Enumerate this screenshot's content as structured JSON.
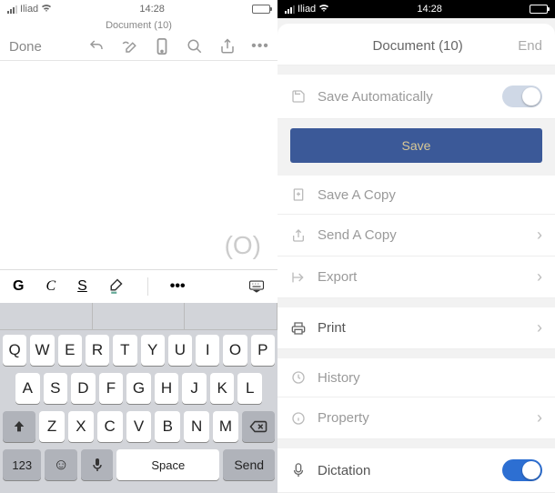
{
  "status": {
    "carrier": "Iliad",
    "time": "14:28"
  },
  "left": {
    "doc_title": "Document (10)",
    "done": "Done",
    "format": {
      "bold": "G",
      "italic": "C",
      "underline": "S",
      "more": "•••"
    },
    "cursor_badge": "(O)"
  },
  "keyboard": {
    "row1": [
      "Q",
      "W",
      "E",
      "R",
      "T",
      "Y",
      "U",
      "I",
      "O",
      "P"
    ],
    "row2": [
      "A",
      "S",
      "D",
      "F",
      "G",
      "H",
      "J",
      "K",
      "L"
    ],
    "row3": [
      "Z",
      "X",
      "C",
      "V",
      "B",
      "N",
      "M"
    ],
    "num": "123",
    "space": "Space",
    "send": "Send"
  },
  "right": {
    "title": "Document (10)",
    "end": "End",
    "save_auto": "Save Automatically",
    "save": "Save",
    "save_copy": "Save A Copy",
    "send_copy": "Send A Copy",
    "export": "Export",
    "print": "Print",
    "history": "History",
    "property": "Property",
    "dictation": "Dictation"
  }
}
